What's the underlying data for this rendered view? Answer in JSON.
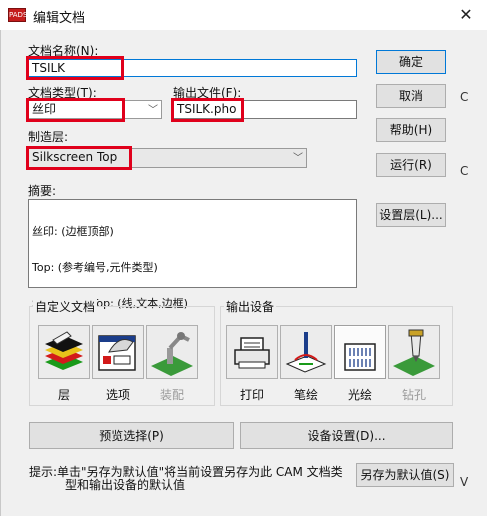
{
  "window": {
    "title": "编辑文档",
    "app_icon_text": "PADS"
  },
  "fields": {
    "doc_name_label": "文档名称(N):",
    "doc_name_value": "TSILK",
    "doc_type_label": "文档类型(T):",
    "doc_type_value": "丝印",
    "output_file_label": "输出文件(F):",
    "output_file_value": "TSILK.pho",
    "layer_label": "制造层:",
    "layer_value": "Silkscreen Top",
    "summary_label": "摘要:",
    "summary_lines": [
      "丝印: (边框顶部)",
      "Top: (参考编号,元件类型)",
      "Silkscreen Top: (线,文本,边框)"
    ]
  },
  "buttons": {
    "ok": "确定",
    "cancel": "取消",
    "help": "帮助(H)",
    "run": "运行(R)",
    "layer_settings": "设置层(L)...",
    "preview": "预览选择(P)",
    "device_setup": "设备设置(D)...",
    "save_default": "另存为默认值(S)"
  },
  "custom_doc": {
    "title": "自定义文档",
    "tools": [
      {
        "label": "层",
        "icon": "layers-icon",
        "enabled": true
      },
      {
        "label": "选项",
        "icon": "options-icon",
        "enabled": true
      },
      {
        "label": "装配",
        "icon": "assembly-icon",
        "enabled": false
      }
    ]
  },
  "output_device": {
    "title": "输出设备",
    "tools": [
      {
        "label": "打印",
        "icon": "printer-icon",
        "selected": false,
        "enabled": true
      },
      {
        "label": "笔绘",
        "icon": "pen-plotter-icon",
        "selected": false,
        "enabled": true
      },
      {
        "label": "光绘",
        "icon": "photoplotter-icon",
        "selected": true,
        "enabled": true
      },
      {
        "label": "钻孔",
        "icon": "drill-icon",
        "selected": false,
        "enabled": false
      }
    ]
  },
  "hint": {
    "line1": "提示:单击\"另存为默认值\"将当前设置另存为此 CAM 文档类",
    "line2": "型和输出设备的默认值"
  },
  "colors": {
    "highlight": "#e0001b",
    "focus": "#0078d7"
  }
}
